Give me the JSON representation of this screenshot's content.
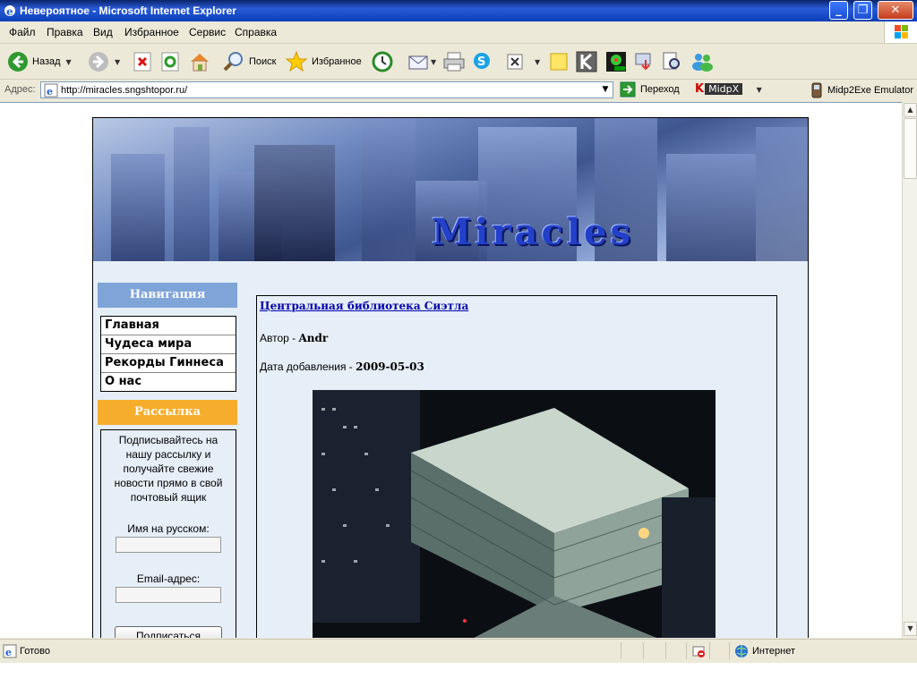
{
  "window": {
    "title": "Невероятное - Microsoft Internet Explorer"
  },
  "menu": [
    "Файл",
    "Правка",
    "Вид",
    "Избранное",
    "Сервис",
    "Справка"
  ],
  "toolbar": {
    "back_label": "Назад",
    "search_label": "Поиск",
    "favorites_label": "Избранное"
  },
  "address": {
    "label": "Адрес:",
    "url": "http://miracles.sngshtopor.ru/",
    "go_label": "Переход",
    "midp_label": "MidpX",
    "midp2exe_label": "Midp2Exe Emulator"
  },
  "site": {
    "brand": "Miracles",
    "nav_heading": "Навигация",
    "nav_items": [
      "Главная",
      "Чудеса мира",
      "Рекорды Гиннеса",
      "О нас"
    ],
    "subscribe_heading": "Рассылка",
    "subscribe_desc": "Подписывайтесь на нашу рассылку и получайте свежие новости прямо в свой почтовый ящик",
    "name_label": "Имя на русском:",
    "email_label": "Email-адрес:",
    "subscribe_button": "Подписаться"
  },
  "article": {
    "title": "Центральная библиотека Сиэтла",
    "author_prefix": "Автор - ",
    "author": "Andr",
    "date_prefix": "Дата добавления - ",
    "date": "2009-05-03"
  },
  "status": {
    "text": "Готово",
    "zone": "Интернет"
  }
}
